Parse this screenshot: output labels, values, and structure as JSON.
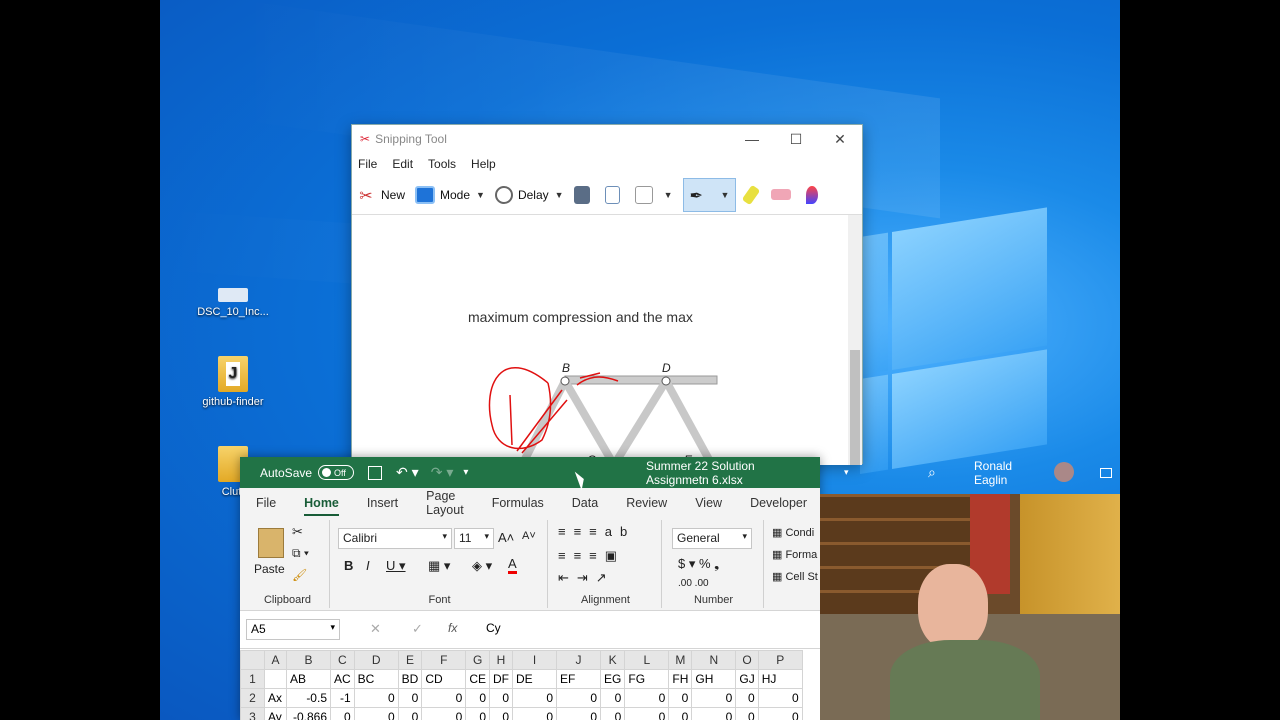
{
  "desktop": {
    "icons": [
      {
        "label": "DSC_10_Inc..."
      },
      {
        "label": "github-finder"
      },
      {
        "label": "Clutt"
      }
    ]
  },
  "snipping_tool": {
    "title": "Snipping Tool",
    "menu": [
      "File",
      "Edit",
      "Tools",
      "Help"
    ],
    "toolbar": {
      "new": "New",
      "mode": "Mode",
      "delay": "Delay"
    },
    "canvas_text": "maximum compression and the max",
    "labels": {
      "b": "B",
      "d": "D",
      "c": "C",
      "e": "E"
    }
  },
  "excel": {
    "autosave": "AutoSave",
    "autosave_state": "Off",
    "file_title": "Summer 22 Solution Assignmetn 6.xlsx",
    "user": "Ronald Eaglin",
    "tabs": [
      "File",
      "Home",
      "Insert",
      "Page Layout",
      "Formulas",
      "Data",
      "Review",
      "View",
      "Developer"
    ],
    "active_tab": "Home",
    "ribbon": {
      "paste": "Paste",
      "clipboard": "Clipboard",
      "font_name": "Calibri",
      "font_size": "11",
      "font_group": "Font",
      "alignment_group": "Alignment",
      "number_format": "General",
      "number_group": "Number",
      "styles": [
        "Condi",
        "Forma",
        "Cell St"
      ]
    },
    "name_box": "A5",
    "formula_value": "Cy",
    "columns": [
      "A",
      "B",
      "C",
      "D",
      "E",
      "F",
      "G",
      "H",
      "I",
      "J",
      "K",
      "L",
      "M",
      "N",
      "O",
      "P"
    ],
    "rows": [
      {
        "n": "1",
        "cells": [
          "",
          "AB",
          "AC",
          "BC",
          "BD",
          "CD",
          "CE",
          "DF",
          "DE",
          "EF",
          "EG",
          "FG",
          "FH",
          "GH",
          "GJ",
          "HJ"
        ]
      },
      {
        "n": "2",
        "cells": [
          "Ax",
          "-0.5",
          "-1",
          "0",
          "0",
          "0",
          "0",
          "0",
          "0",
          "0",
          "0",
          "0",
          "0",
          "0",
          "0",
          "0"
        ]
      },
      {
        "n": "3",
        "cells": [
          "Ay",
          "-0.866",
          "0",
          "0",
          "0",
          "0",
          "0",
          "0",
          "0",
          "0",
          "0",
          "0",
          "0",
          "0",
          "0",
          "0"
        ]
      }
    ]
  },
  "colors": {
    "excel_green": "#217346",
    "desktop_blue": "#0b6fd6"
  }
}
